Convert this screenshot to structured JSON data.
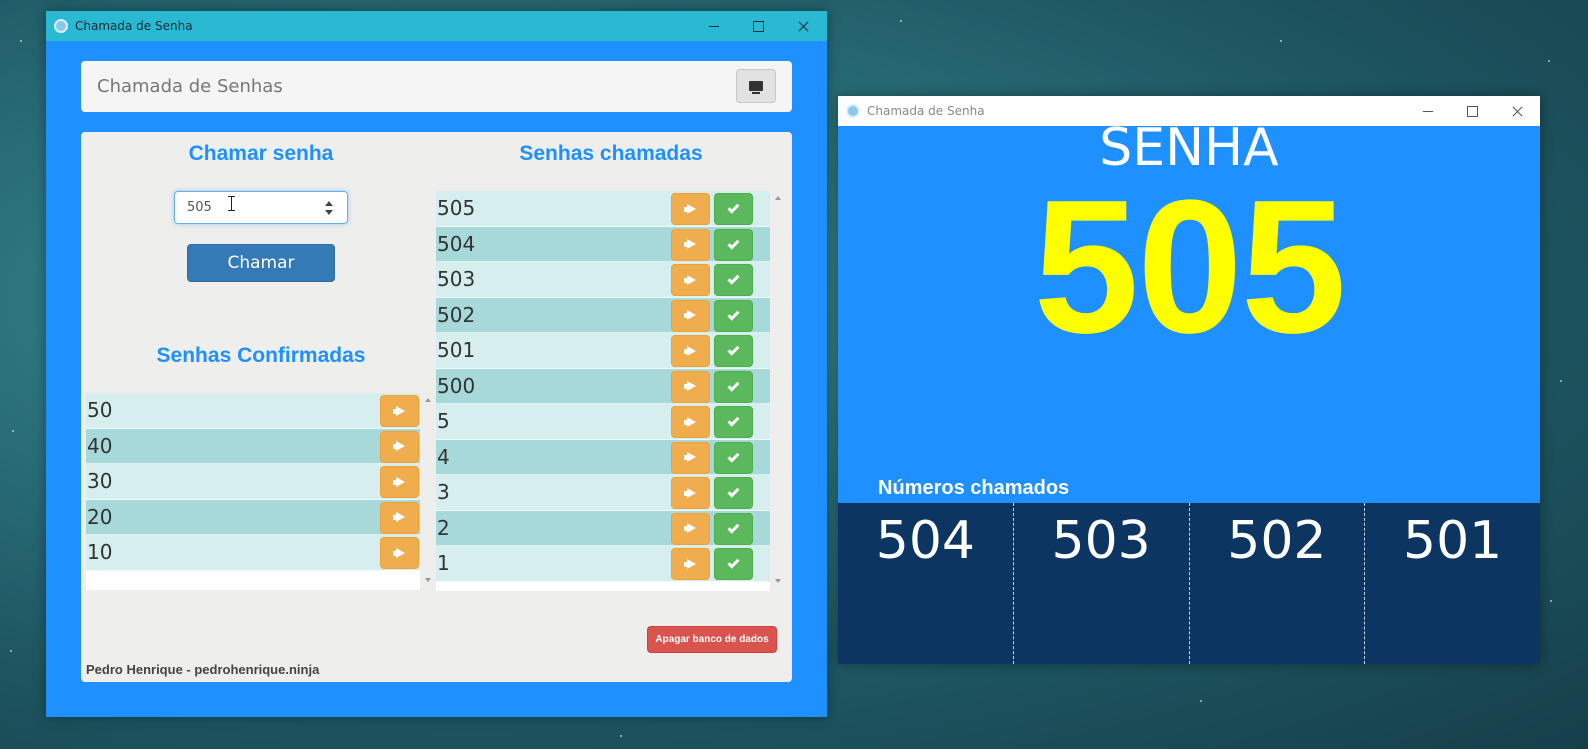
{
  "main_window": {
    "title": "Chamada de Senha",
    "topbar_title": "Chamada de Senhas",
    "call_section": {
      "heading": "Chamar senha",
      "input_value": "505",
      "button_label": "Chamar"
    },
    "confirmed_section": {
      "heading": "Senhas Confirmadas",
      "items": [
        "50",
        "40",
        "30",
        "20",
        "10"
      ]
    },
    "called_section": {
      "heading": "Senhas chamadas",
      "items": [
        "505",
        "504",
        "503",
        "502",
        "501",
        "500",
        "5",
        "4",
        "3",
        "2",
        "1"
      ]
    },
    "delete_button_label": "Apagar banco de dados",
    "footer": "Pedro Henrique - pedrohenrique.ninja"
  },
  "display_window": {
    "title": "Chamada de Senha",
    "label": "SENHA",
    "current_number": "505",
    "called_title": "Números chamados",
    "called_numbers": [
      "504",
      "503",
      "502",
      "501"
    ]
  },
  "colors": {
    "app_background": "#1e90ff",
    "heading": "#1e90ff",
    "current_number": "#ffff00",
    "called_grid_background": "#0c3562",
    "row_light": "#d6efee",
    "row_dark": "#a8d9da",
    "warning_button": "#f0ad4e",
    "success_button": "#5cb85c",
    "danger_button": "#d9534f",
    "primary_button": "#337ab7"
  },
  "icons": {
    "call_again": "bullhorn-icon",
    "confirm": "check-icon",
    "display_toggle": "monitor-icon"
  }
}
